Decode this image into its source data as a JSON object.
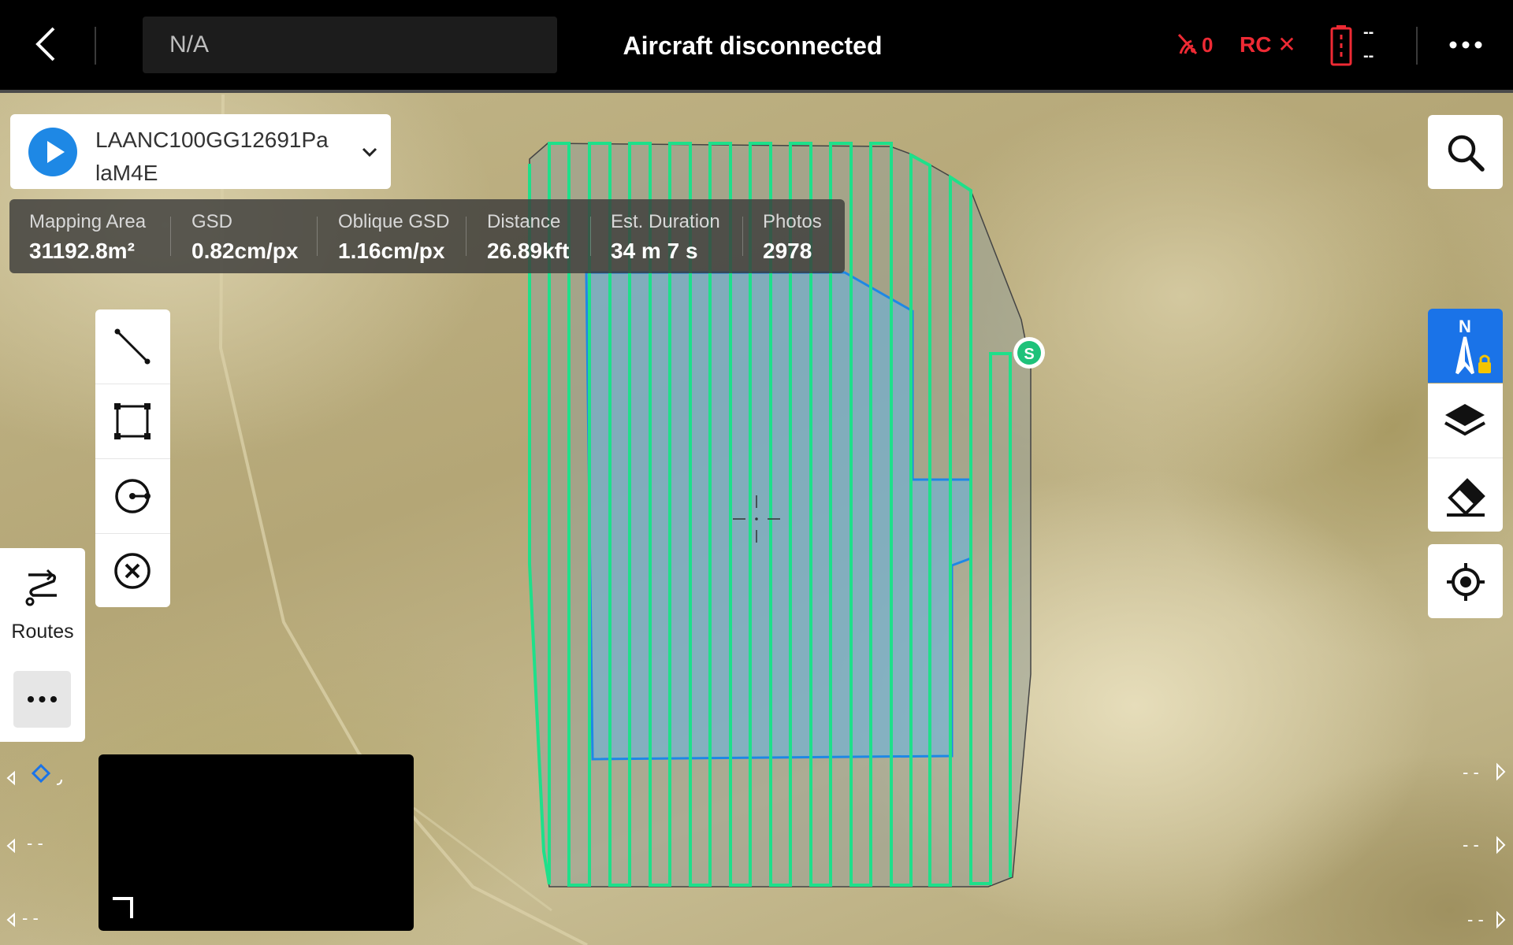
{
  "header": {
    "mission_name_placeholder": "N/A",
    "title": "Aircraft disconnected",
    "signal_count": "0",
    "rc_label": "RC",
    "rc_status_mark": "✕",
    "battery_value_top": "--",
    "battery_value_bottom": "--"
  },
  "route_selector": {
    "name": "LAANC100GG12691PalaM4E"
  },
  "stats": [
    {
      "label": "Mapping Area",
      "value": "31192.8m²"
    },
    {
      "label": "GSD",
      "value": "0.82cm/px"
    },
    {
      "label": "Oblique GSD",
      "value": "1.16cm/px"
    },
    {
      "label": "Distance",
      "value": "26.89kft"
    },
    {
      "label": "Est. Duration",
      "value": "34 m 7 s"
    },
    {
      "label": "Photos",
      "value": "2978"
    }
  ],
  "left_panel": {
    "routes_label": "Routes"
  },
  "map": {
    "start_marker_label": "S",
    "compass_label": "N"
  },
  "side_indicators": {
    "left_row2": "- -",
    "left_row3": "- -",
    "right_row1": "- -",
    "right_row2": "- -",
    "right_row3": "- -"
  },
  "colors": {
    "accent_blue": "#1e88e5",
    "route_green": "#1ee08a",
    "warning_red": "#ee2a34",
    "area_blue": "#64b4e6"
  }
}
